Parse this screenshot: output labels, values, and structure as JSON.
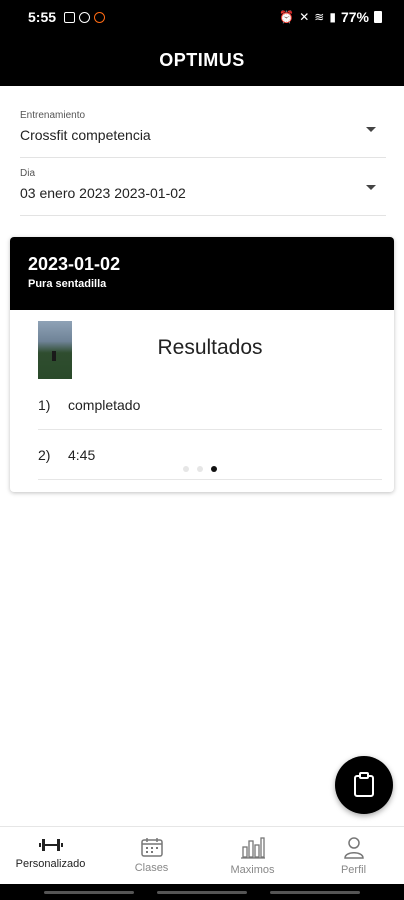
{
  "status_bar": {
    "time": "5:55",
    "battery": "77%"
  },
  "app_bar": {
    "title": "OPTIMUS"
  },
  "filters": {
    "entrenamiento": {
      "label": "Entrenamiento",
      "value": "Crossfit competencia"
    },
    "dia": {
      "label": "Dia",
      "value": "03 enero 2023 2023-01-02"
    }
  },
  "card": {
    "date": "2023-01-02",
    "subtitle": "Pura sentadilla",
    "results_title": "Resultados",
    "results": [
      {
        "num": "1)",
        "text": "completado"
      },
      {
        "num": "2)",
        "text": "4:45"
      }
    ],
    "pagination": {
      "total": 3,
      "active": 3
    }
  },
  "fab": {
    "icon": "clipboard-icon"
  },
  "bottom_nav": {
    "items": [
      {
        "label": "Personalizado",
        "icon": "dumbbell-icon",
        "active": true
      },
      {
        "label": "Clases",
        "icon": "calendar-icon",
        "active": false
      },
      {
        "label": "Maximos",
        "icon": "bar-chart-icon",
        "active": false
      },
      {
        "label": "Perfil",
        "icon": "person-icon",
        "active": false
      }
    ]
  },
  "colors": {
    "primary": "#000000",
    "accent_status": "#ff6a13"
  }
}
